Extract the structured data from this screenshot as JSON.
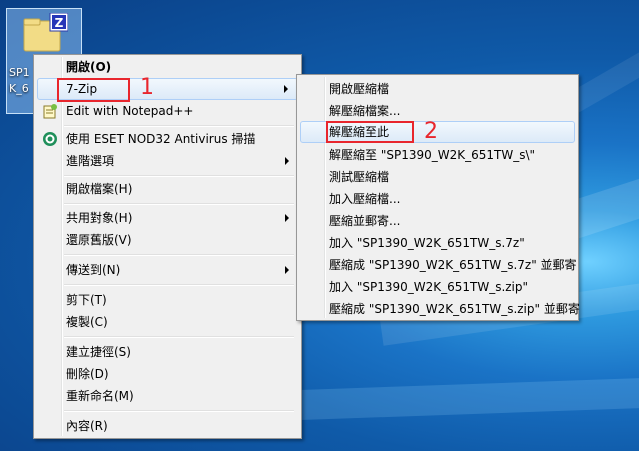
{
  "desktop": {
    "file_icon_label": "SP1\nK_6",
    "file_icon_badge": "Z"
  },
  "context_menu": {
    "items": [
      {
        "label": "開啟(O)"
      },
      {
        "label": "7-Zip"
      },
      {
        "label": "Edit with Notepad++"
      },
      {
        "label": "使用 ESET NOD32 Antivirus 掃描"
      },
      {
        "label": "進階選項"
      },
      {
        "label": "開啟檔案(H)"
      },
      {
        "label": "共用對象(H)"
      },
      {
        "label": "還原舊版(V)"
      },
      {
        "label": "傳送到(N)"
      },
      {
        "label": "剪下(T)"
      },
      {
        "label": "複製(C)"
      },
      {
        "label": "建立捷徑(S)"
      },
      {
        "label": "刪除(D)"
      },
      {
        "label": "重新命名(M)"
      },
      {
        "label": "內容(R)"
      }
    ]
  },
  "submenu_7zip": {
    "items": [
      {
        "label": "開啟壓縮檔"
      },
      {
        "label": "解壓縮檔案..."
      },
      {
        "label": "解壓縮至此"
      },
      {
        "label": "解壓縮至 \"SP1390_W2K_651TW_s\\\""
      },
      {
        "label": "測試壓縮檔"
      },
      {
        "label": "加入壓縮檔..."
      },
      {
        "label": "壓縮並郵寄..."
      },
      {
        "label": "加入 \"SP1390_W2K_651TW_s.7z\""
      },
      {
        "label": "壓縮成 \"SP1390_W2K_651TW_s.7z\" 並郵寄"
      },
      {
        "label": "加入 \"SP1390_W2K_651TW_s.zip\""
      },
      {
        "label": "壓縮成 \"SP1390_W2K_651TW_s.zip\" 並郵寄"
      }
    ]
  },
  "annotations": {
    "step1": "1",
    "step2": "2"
  },
  "colors": {
    "callout": "#e8262d",
    "menu_bg": "#f0f0f0",
    "highlight_border": "#aecff7"
  },
  "icons": [
    "zip-file-icon",
    "notepad-plus-plus-icon",
    "eset-antivirus-icon",
    "submenu-arrow-icon"
  ]
}
